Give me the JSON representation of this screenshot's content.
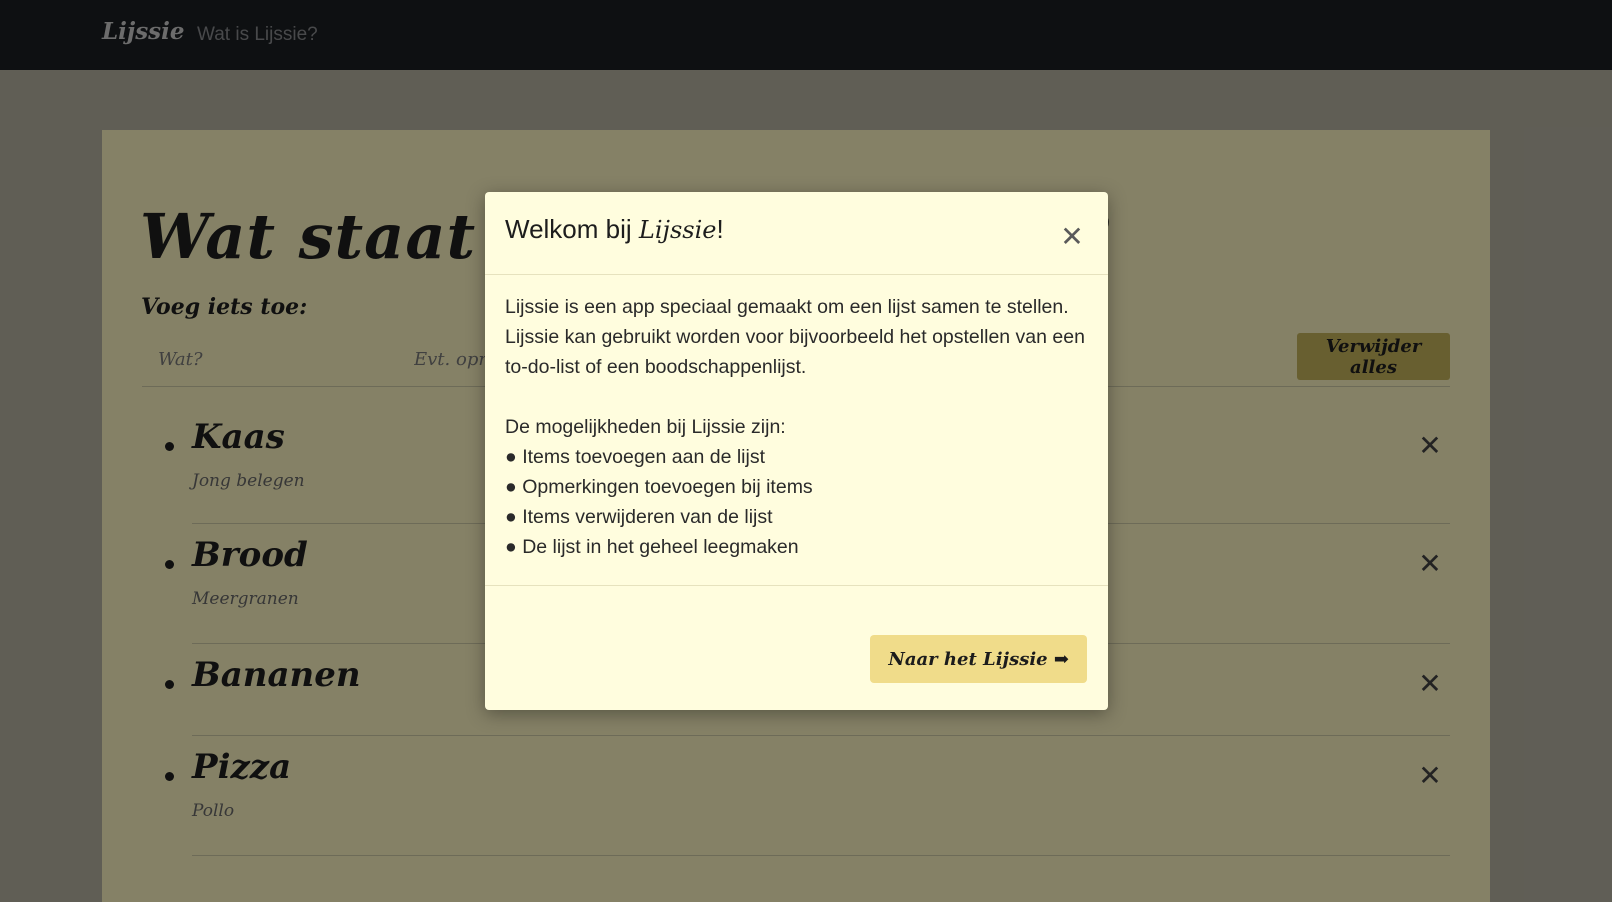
{
  "navbar": {
    "brand": "Lijssie",
    "link": "Wat is Lijssie?"
  },
  "page": {
    "title": "Wat staat er op het Lijssie?",
    "add_label": "Voeg iets toe:",
    "what_placeholder": "Wat?",
    "note_placeholder": "Evt. opmerking",
    "clear_all_label": "Verwijder alles"
  },
  "items": [
    {
      "name": "Kaas",
      "note": "Jong belegen"
    },
    {
      "name": "Brood",
      "note": "Meergranen"
    },
    {
      "name": "Bananen",
      "note": ""
    },
    {
      "name": "Pizza",
      "note": "Pollo"
    }
  ],
  "remove_symbol": "✕",
  "modal": {
    "title_prefix": "Welkom bij ",
    "title_brand": "Lijssie",
    "title_suffix": "!",
    "close_symbol": "✕",
    "intro": "Lijssie is een app speciaal gemaakt om een lijst samen te stellen. Lijssie kan gebruikt worden voor bijvoorbeeld het opstellen van een to-do-list of een boodschappenlijst.",
    "features_heading": "De mogelijkheden bij Lijssie zijn:",
    "features": [
      "● Items toevoegen aan de lijst",
      "● Opmerkingen toevoegen bij items",
      "● Items verwijderen van de lijst",
      "● De lijst in het geheel leegmaken"
    ],
    "button_label": "Naar het Lijssie",
    "button_icon": "➡"
  },
  "colors": {
    "navbar": "#1c2023",
    "jumbotron": "#fff7c4",
    "modal": "#fffdde",
    "accent_button": "#f0dc8a"
  }
}
